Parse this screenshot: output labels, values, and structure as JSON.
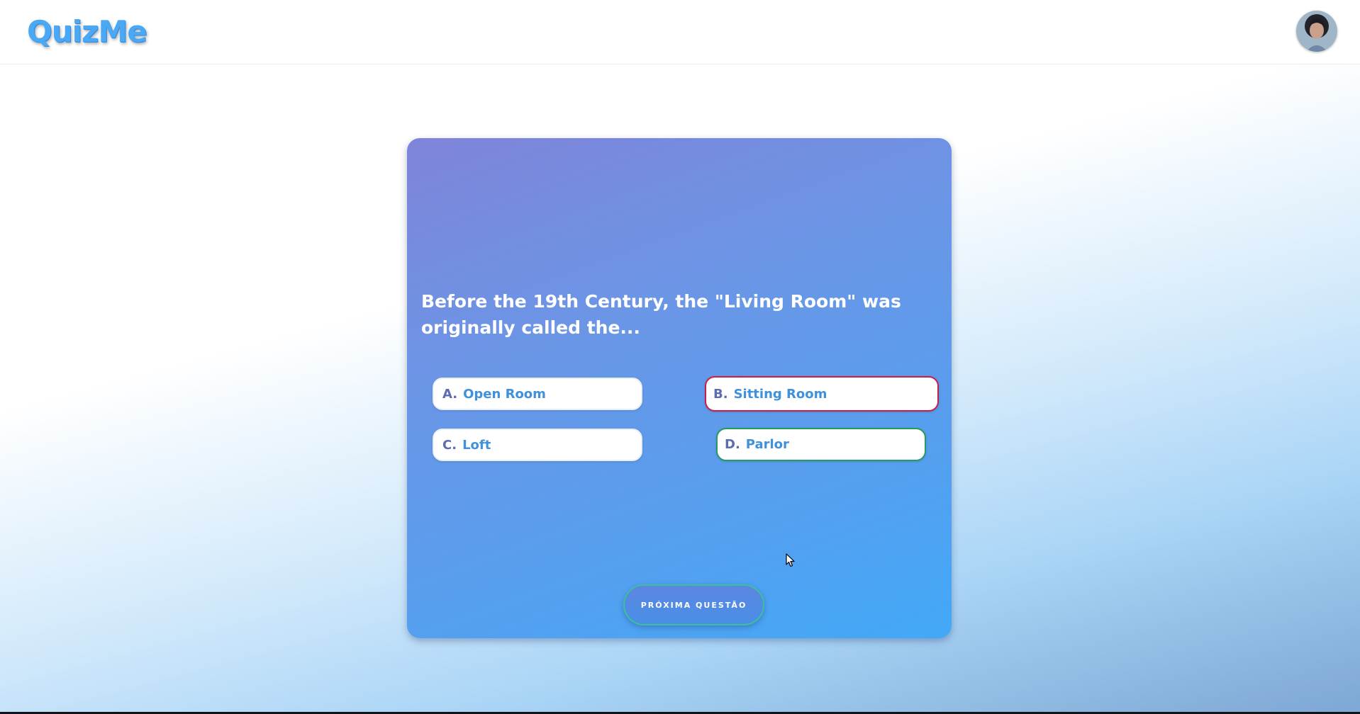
{
  "header": {
    "logo": "QuizMe",
    "avatar_icon": "user-avatar-icon"
  },
  "quiz": {
    "question": "Before the 19th Century, the \"Living Room\" was originally called the...",
    "options": [
      {
        "letter": "A.",
        "text": "Open Room",
        "state": "default"
      },
      {
        "letter": "B.",
        "text": "Sitting Room",
        "state": "incorrect"
      },
      {
        "letter": "C.",
        "text": "Loft",
        "state": "default"
      },
      {
        "letter": "D.",
        "text": "Parlor",
        "state": "correct"
      }
    ],
    "next_button": "PRÓXIMA QUESTÃO"
  },
  "colors": {
    "brand": "#4aa8f4",
    "incorrect": "#cc1d4a",
    "correct": "#279a61",
    "card_gradient_start": "#7f84d9",
    "card_gradient_end": "#43a8f8"
  }
}
